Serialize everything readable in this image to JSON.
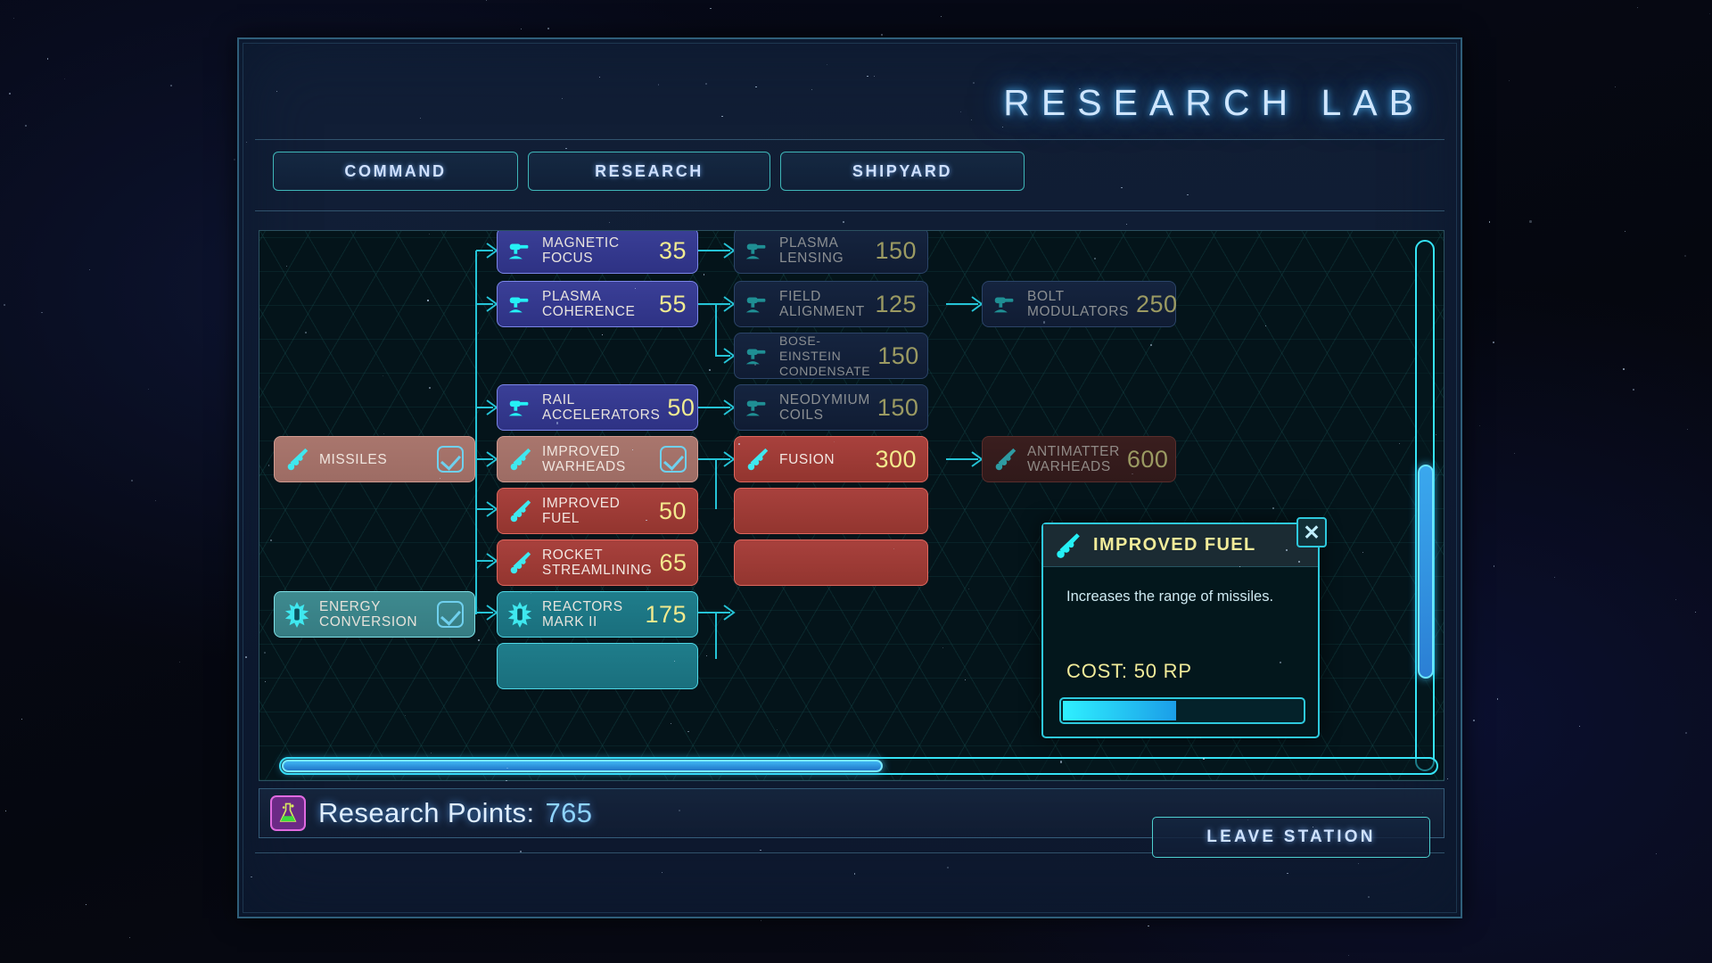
{
  "window": {
    "title": "RESEARCH LAB"
  },
  "tabs": [
    {
      "label": "COMMAND",
      "active": false
    },
    {
      "label": "RESEARCH",
      "active": true
    },
    {
      "label": "SHIPYARD",
      "active": false
    }
  ],
  "tree": {
    "nodes": [
      {
        "name": "MAGNETIC FOCUS",
        "line1": "MAGNETIC",
        "line2": "FOCUS",
        "cost": "35",
        "state": "available",
        "branch": "weapons",
        "icon": "turret-icon"
      },
      {
        "name": "PLASMA LENSING",
        "line1": "PLASMA",
        "line2": "LENSING",
        "cost": "150",
        "state": "locked",
        "branch": "weapons",
        "icon": "turret-icon"
      },
      {
        "name": "PLASMA COHERENCE",
        "line1": "PLASMA",
        "line2": "COHERENCE",
        "cost": "55",
        "state": "available",
        "branch": "weapons",
        "icon": "turret-icon"
      },
      {
        "name": "FIELD ALIGNMENT",
        "line1": "FIELD",
        "line2": "ALIGNMENT",
        "cost": "125",
        "state": "locked",
        "branch": "weapons",
        "icon": "turret-icon"
      },
      {
        "name": "BOLT MODULATORS",
        "line1": "BOLT",
        "line2": "MODULATORS",
        "cost": "250",
        "state": "locked",
        "branch": "weapons",
        "icon": "turret-icon"
      },
      {
        "name": "BOSE-EINSTEIN CONDENSATE",
        "line1": "BOSE-EINSTEIN",
        "line2": "CONDENSATE",
        "cost": "150",
        "state": "locked",
        "branch": "weapons",
        "icon": "turret-icon"
      },
      {
        "name": "RAIL ACCELERATORS",
        "line1": "RAIL",
        "line2": "ACCELERATORS",
        "cost": "50",
        "state": "available",
        "branch": "weapons",
        "icon": "turret-icon"
      },
      {
        "name": "NEODYMIUM COILS",
        "line1": "NEODYMIUM",
        "line2": "COILS",
        "cost": "150",
        "state": "locked",
        "branch": "weapons",
        "icon": "turret-icon"
      },
      {
        "name": "MISSILES",
        "line1": "MISSILES",
        "line2": "",
        "cost": "",
        "state": "researched",
        "branch": "missiles",
        "icon": "missile-icon"
      },
      {
        "name": "IMPROVED WARHEADS",
        "line1": "IMPROVED",
        "line2": "WARHEADS",
        "cost": "",
        "state": "researched",
        "branch": "missiles",
        "icon": "missile-icon"
      },
      {
        "name": "FUSION",
        "line1": "FUSION",
        "line2": "",
        "cost": "300",
        "state": "available",
        "branch": "missiles",
        "icon": "missile-icon"
      },
      {
        "name": "ANTIMATTER WARHEADS",
        "line1": "ANTIMATTER",
        "line2": "WARHEADS",
        "cost": "600",
        "state": "locked",
        "branch": "missiles",
        "icon": "missile-icon"
      },
      {
        "name": "IMPROVED FUEL",
        "line1": "IMPROVED",
        "line2": "FUEL",
        "cost": "50",
        "state": "available",
        "branch": "missiles",
        "icon": "missile-icon"
      },
      {
        "name": "ROCKET STREAMLINING",
        "line1": "ROCKET",
        "line2": "STREAMLINING",
        "cost": "65",
        "state": "available",
        "branch": "missiles",
        "icon": "missile-icon"
      },
      {
        "name": "ENERGY CONVERSION",
        "line1": "ENERGY",
        "line2": "CONVERSION",
        "cost": "",
        "state": "researched",
        "branch": "energy",
        "icon": "reactor-icon"
      },
      {
        "name": "REACTORS MARK II",
        "line1": "REACTORS",
        "line2": "MARK II",
        "cost": "175",
        "state": "available",
        "branch": "energy",
        "icon": "reactor-icon"
      }
    ]
  },
  "scrollbars": {
    "vertical_thumb_percent": 40,
    "horizontal_thumb_percent": 52
  },
  "tooltip": {
    "title": "IMPROVED FUEL",
    "description": "Increases the range of missiles.",
    "cost_label": "COST: 50 RP",
    "progress_percent": 48,
    "close_label": "✕",
    "icon": "missile-icon"
  },
  "status": {
    "research_points_label": "Research Points:",
    "research_points_value": "765",
    "flask_icon": "flask-icon"
  },
  "footer": {
    "leave_label": "LEAVE STATION"
  },
  "colors": {
    "accent_cyan": "#2ec9dd",
    "title_blue": "#cfe6ff",
    "cost_yellow": "#f0eb92",
    "available_weapon": "#3a3f97",
    "available_missile": "#a8413d",
    "researched_missile": "#a9766d",
    "energy_teal": "#1f7d8b"
  }
}
